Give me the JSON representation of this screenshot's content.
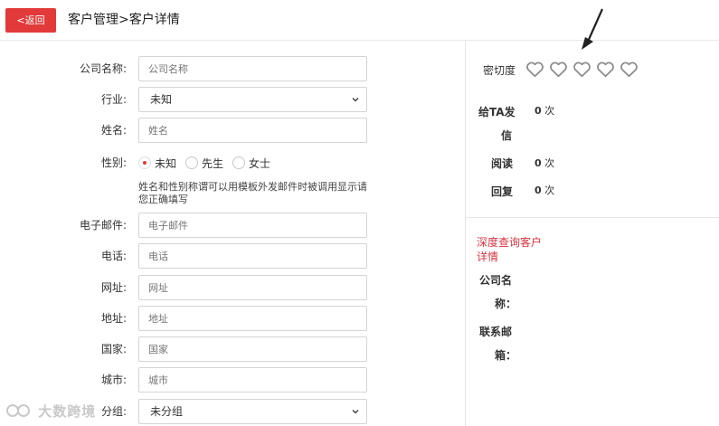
{
  "header": {
    "back_label": "<返回",
    "title": "客户管理>客户详情"
  },
  "form": {
    "company": {
      "label": "公司名称:",
      "placeholder": "公司名称"
    },
    "industry": {
      "label": "行业:",
      "value": "未知"
    },
    "name": {
      "label": "姓名:",
      "placeholder": "姓名"
    },
    "gender": {
      "label": "性别:",
      "options": [
        {
          "label": "未知",
          "checked": true
        },
        {
          "label": "先生",
          "checked": false
        },
        {
          "label": "女士",
          "checked": false
        }
      ]
    },
    "hint": "姓名和性别称谓可以用模板外发邮件时被调用显示请您正确填写",
    "email": {
      "label": "电子邮件:",
      "placeholder": "电子邮件"
    },
    "phone": {
      "label": "电话:",
      "placeholder": "电话"
    },
    "website": {
      "label": "网址:",
      "placeholder": "网址"
    },
    "address": {
      "label": "地址:",
      "placeholder": "地址"
    },
    "country": {
      "label": "国家:",
      "placeholder": "国家"
    },
    "city": {
      "label": "城市:",
      "placeholder": "城市"
    },
    "group": {
      "label": "分组:",
      "value": "未分组"
    }
  },
  "right": {
    "intimacy_label": "密切度",
    "intimacy_level": 0,
    "intimacy_max": 5,
    "send_label_1": "给TA发",
    "send_label_2": "信",
    "send_count": "0",
    "read_label": "阅读",
    "read_count": "0",
    "reply_label": "回复",
    "reply_count": "0",
    "unit": "次",
    "deep_query_link": "深度查询客户详情",
    "company_label_1": "公司名",
    "company_label_2": "称：",
    "email_label_1": "联系邮",
    "email_label_2": "箱："
  },
  "watermark": "大数跨境",
  "colors": {
    "accent": "#e23a3a",
    "link": "#d9333f"
  }
}
